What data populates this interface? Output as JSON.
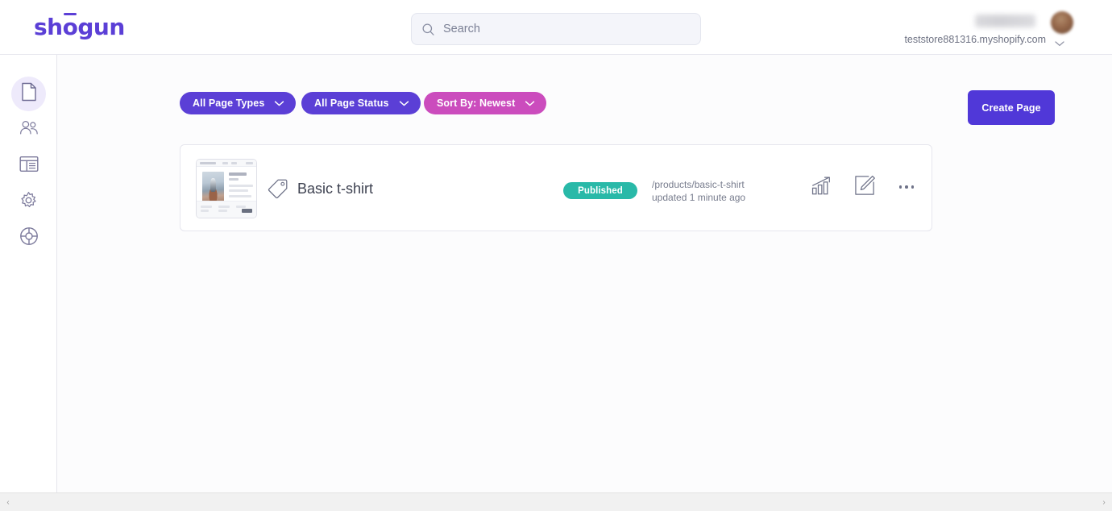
{
  "brand": {
    "name": "shogun",
    "logo_color": "#5b3fd6"
  },
  "topbar": {
    "search": {
      "icon": "search-icon",
      "placeholder": "Search",
      "value": ""
    },
    "account": {
      "user_name_redacted": "",
      "store_name": "teststore881316.myshopify.com",
      "caret_icon": "chevron-down-icon",
      "avatar_icon": "avatar"
    }
  },
  "sidebar": {
    "items": [
      {
        "name": "sidebar-item-pages",
        "icon": "page-icon",
        "active": true
      },
      {
        "name": "sidebar-item-users",
        "icon": "users-icon",
        "active": false
      },
      {
        "name": "sidebar-item-templates",
        "icon": "layout-icon",
        "active": false
      },
      {
        "name": "sidebar-item-settings",
        "icon": "gear-icon",
        "active": false
      },
      {
        "name": "sidebar-item-help",
        "icon": "lifebuoy-icon",
        "active": false
      }
    ]
  },
  "toolbar": {
    "filters": [
      {
        "label": "All Page Types",
        "color": "#5b3fd6",
        "icon": "chevron-down-icon"
      },
      {
        "label": "All Page Status",
        "color": "#5b3fd6",
        "icon": "chevron-down-icon"
      },
      {
        "label": "Sort By: Newest",
        "color": "#cb4cbd",
        "icon": "chevron-down-icon"
      }
    ],
    "create_label": "Create Page",
    "create_color": "#5038d8"
  },
  "page_list": {
    "rows": [
      {
        "title": "Basic t-shirt",
        "type_icon": "tag-icon",
        "status": "Published",
        "status_color": "#29b9a8",
        "path": "/products/basic-t-shirt",
        "updated": "updated 1 minute ago",
        "actions": [
          {
            "name": "analytics-icon",
            "label": "Analytics"
          },
          {
            "name": "edit-icon",
            "label": "Edit"
          },
          {
            "name": "more-options-icon",
            "label": "More"
          }
        ]
      }
    ]
  },
  "scrollbar": {
    "left_arrow": "‹",
    "right_arrow": "›"
  }
}
